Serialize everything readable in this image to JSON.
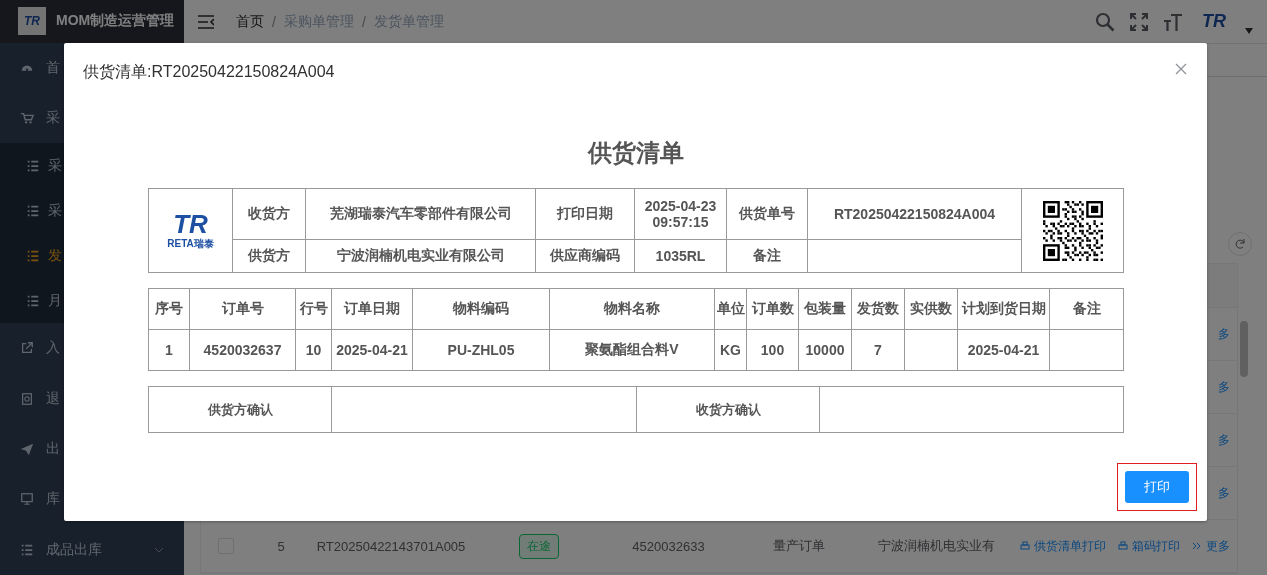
{
  "sidebar": {
    "logo": {
      "mark": "TR"
    },
    "title": "MOM制造运营管理",
    "items": [
      {
        "label": "首",
        "kind": "dashboard"
      },
      {
        "label": "采",
        "kind": "cart",
        "expanded": true,
        "children": [
          {
            "label": "采",
            "selected": false
          },
          {
            "label": "采",
            "selected": false
          },
          {
            "label": "发",
            "selected": true
          },
          {
            "label": "月",
            "selected": false
          }
        ]
      },
      {
        "label": "入",
        "kind": "link-out"
      },
      {
        "label": "退",
        "kind": "receipt"
      },
      {
        "label": "出",
        "kind": "send"
      },
      {
        "label": "库",
        "kind": "monitor"
      },
      {
        "label": "成品出库",
        "kind": "list",
        "expanded": false
      }
    ]
  },
  "header": {
    "breadcrumbs": [
      "首页",
      "采购单管理",
      "发货单管理"
    ],
    "breadcrumb_separator": "/",
    "avatar": {
      "mark": "TR"
    }
  },
  "background_table": {
    "rows": [
      {
        "actions": [
          "多"
        ]
      },
      {
        "actions": [
          "多"
        ]
      },
      {
        "actions": [
          "多"
        ]
      },
      {
        "actions": [
          "多"
        ]
      },
      {
        "checked": false,
        "index": "5",
        "doc_no": "RT20250422143701A005",
        "status": "在途",
        "order_no": "4520032633",
        "type": "量产订单",
        "supplier": "宁波润楠机电实业有",
        "actions": [
          "供货清单打印",
          "箱码打印",
          "更多"
        ]
      }
    ]
  },
  "modal": {
    "title": "供货清单:RT20250422150824A004",
    "document": {
      "title": "供货清单",
      "logo": {
        "mark": "TR",
        "caption": "RETA瑞泰"
      },
      "receiver_label": "收货方",
      "receiver": "芜湖瑞泰汽车零部件有限公司",
      "print_date_label": "打印日期",
      "print_date": "2025-04-23 09:57:15",
      "doc_no_label": "供货单号",
      "doc_no": "RT20250422150824A004",
      "supplier_label": "供货方",
      "supplier": "宁波润楠机电实业有限公司",
      "vendor_code_label": "供应商编码",
      "vendor_code": "1035RL",
      "remark_label": "备注",
      "columns": [
        "序号",
        "订单号",
        "行号",
        "订单日期",
        "物料编码",
        "物料名称",
        "单位",
        "订单数",
        "包装量",
        "发货数",
        "实供数",
        "计划到货日期",
        "备注"
      ],
      "rows": [
        {
          "seq": "1",
          "order_no": "4520032637",
          "line": "10",
          "order_date": "2025-04-21",
          "material_code": "PU-ZHL05",
          "material_name": "聚氨酯组合料V",
          "unit": "KG",
          "order_qty": "100",
          "pack_qty": "10000",
          "ship_qty": "7",
          "plan_date": "2025-04-21"
        }
      ],
      "signatures": [
        "供货方确认",
        "收货方确认"
      ]
    },
    "print_button": {
      "label": "打印",
      "highlighted": true
    }
  }
}
